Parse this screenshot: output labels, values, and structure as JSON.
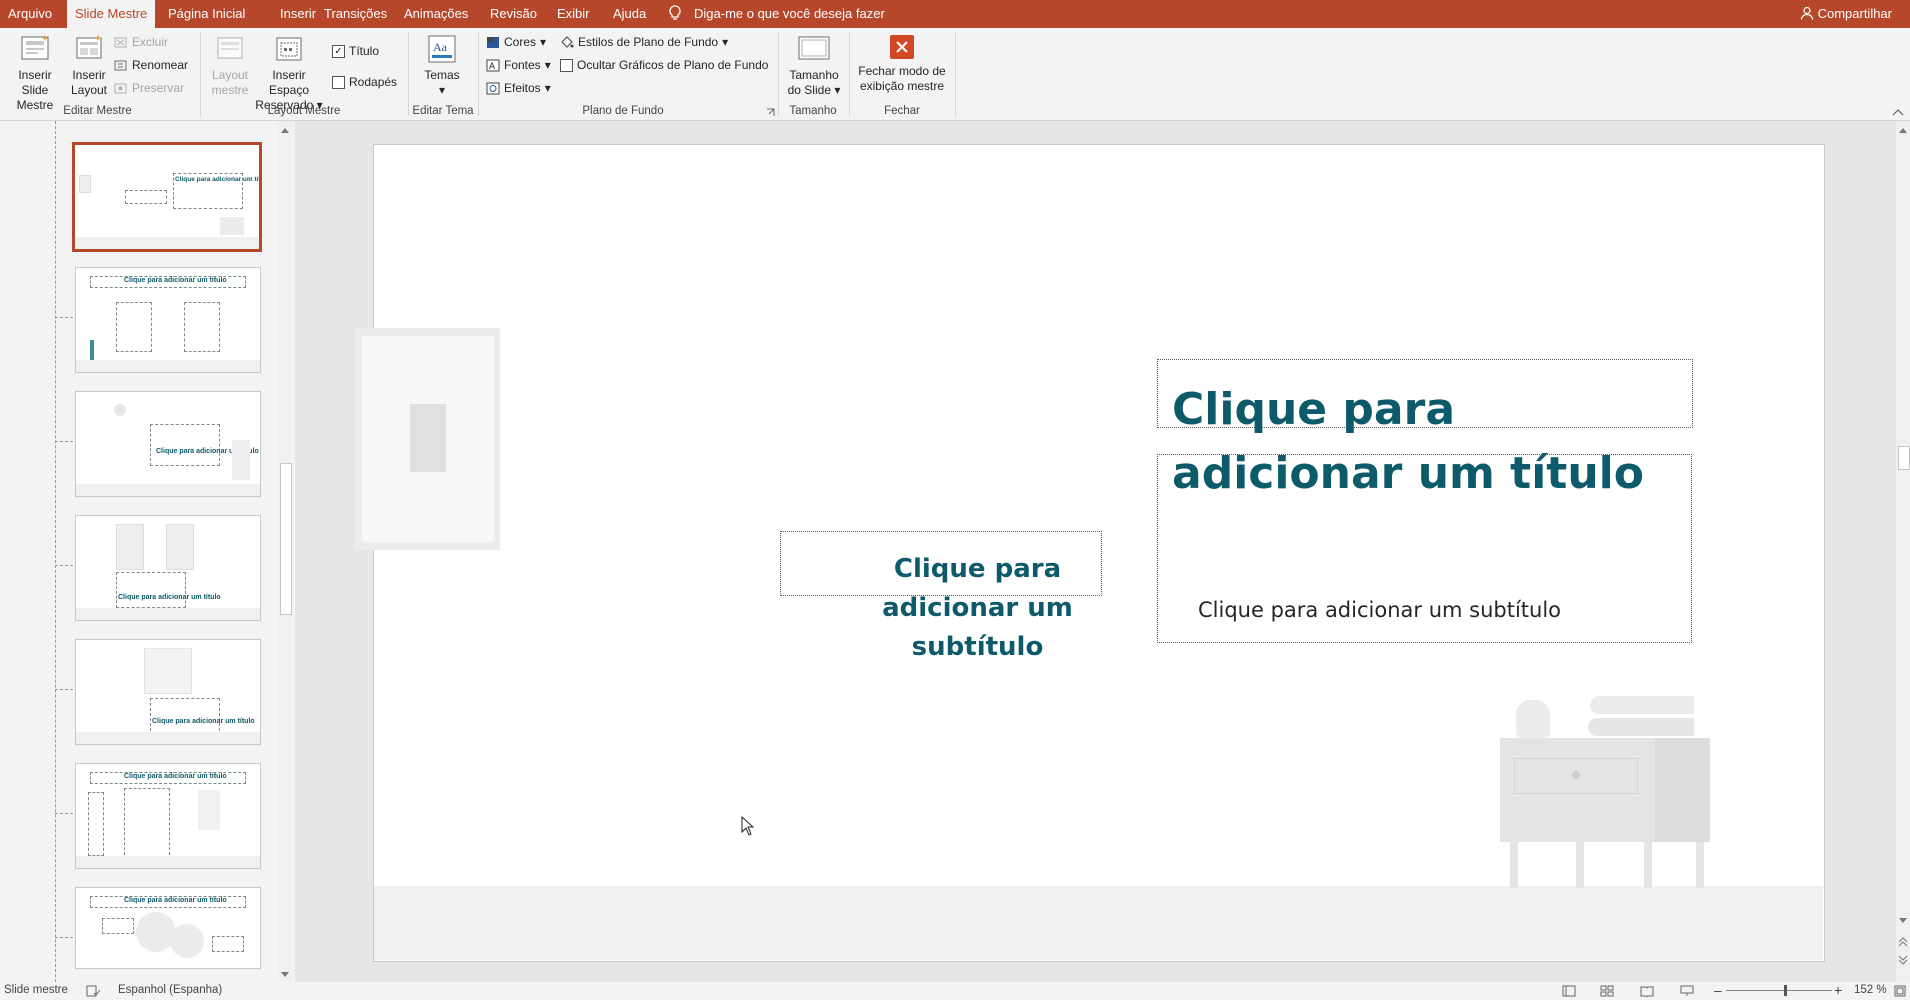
{
  "menu": {
    "items": [
      "Arquivo",
      "Slide Mestre",
      "Página Inicial",
      "Inserir",
      "Transições",
      "Animações",
      "Revisão",
      "Exibir",
      "Ajuda"
    ],
    "active": "Slide Mestre",
    "tell_me": "Diga-me o que você deseja fazer",
    "share": "Compartilhar"
  },
  "ribbon": {
    "editar_mestre": {
      "label": "Editar Mestre",
      "inserir_slide_mestre": "Inserir Slide Mestre",
      "inserir_layout": "Inserir Layout",
      "excluir": "Excluir",
      "renomear": "Renomear",
      "preservar": "Preservar"
    },
    "layout_mestre": {
      "label": "Layout Mestre",
      "layout_mestre_btn": "Layout mestre",
      "inserir_espaco": "Inserir Espaço Reservado",
      "titulo": "Título",
      "rodapes": "Rodapés"
    },
    "editar_tema": {
      "label": "Editar Tema",
      "temas": "Temas"
    },
    "plano_de_fundo": {
      "label": "Plano de Fundo",
      "cores": "Cores",
      "fontes": "Fontes",
      "efeitos": "Efeitos",
      "estilos": "Estilos de Plano de Fundo",
      "ocultar": "Ocultar Gráficos de Plano de Fundo"
    },
    "tamanho": {
      "label": "Tamanho",
      "tamanho_slide": "Tamanho do Slide"
    },
    "fechar": {
      "label": "Fechar",
      "fechar_modo": "Fechar modo de exibição mestre"
    }
  },
  "thumbnails": {
    "title_text": "Clique para adicionar um título",
    "subtitle_small": "Clique para adicionar um subtítulo",
    "items": [
      {
        "kind": "title-slide"
      },
      {
        "kind": "two-content"
      },
      {
        "kind": "picture-right"
      },
      {
        "kind": "windows"
      },
      {
        "kind": "window-single"
      },
      {
        "kind": "list"
      },
      {
        "kind": "circles"
      }
    ]
  },
  "slide": {
    "title": "Clique para adicionar um título",
    "subtitle": "Clique para adicionar um subtítulo",
    "side_text": "Clique para adicionar um subtítulo"
  },
  "status": {
    "view": "Slide mestre",
    "language": "Espanhol (Espanha)",
    "zoom": "152 %"
  },
  "colors": {
    "brand": "#b7472a",
    "title": "#0d5a6b",
    "close_button": "#d24726"
  }
}
